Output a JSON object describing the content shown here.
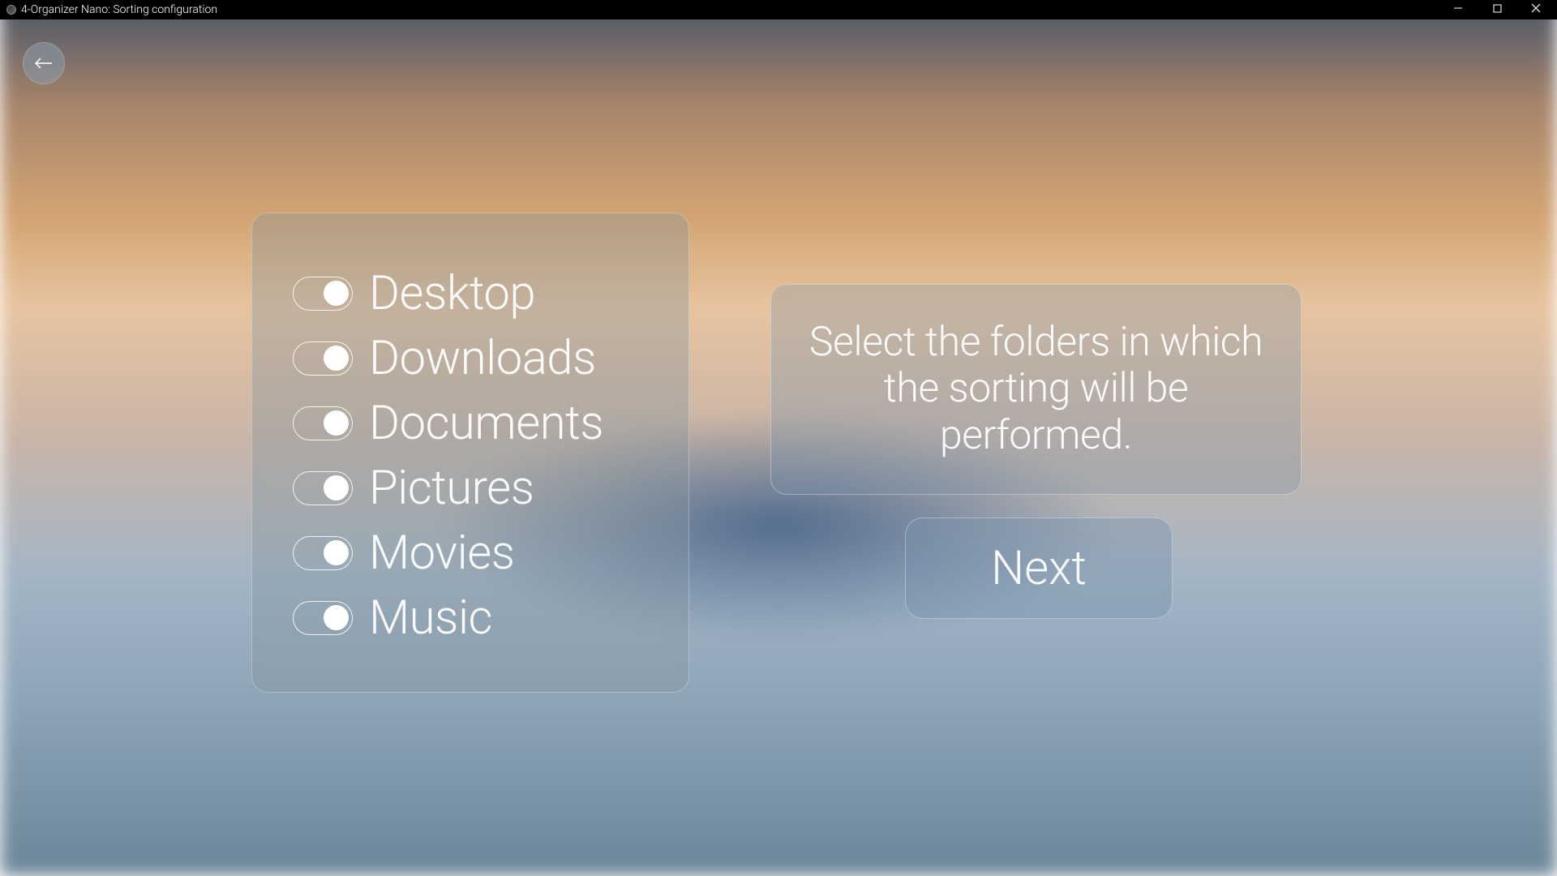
{
  "window": {
    "title": "4-Organizer Nano: Sorting configuration"
  },
  "folders": [
    {
      "label": "Desktop",
      "enabled": true
    },
    {
      "label": "Downloads",
      "enabled": true
    },
    {
      "label": "Documents",
      "enabled": true
    },
    {
      "label": "Pictures",
      "enabled": true
    },
    {
      "label": "Movies",
      "enabled": true
    },
    {
      "label": "Music",
      "enabled": true
    }
  ],
  "instruction": "Select the folders in which the sorting will be performed.",
  "next_button": "Next"
}
